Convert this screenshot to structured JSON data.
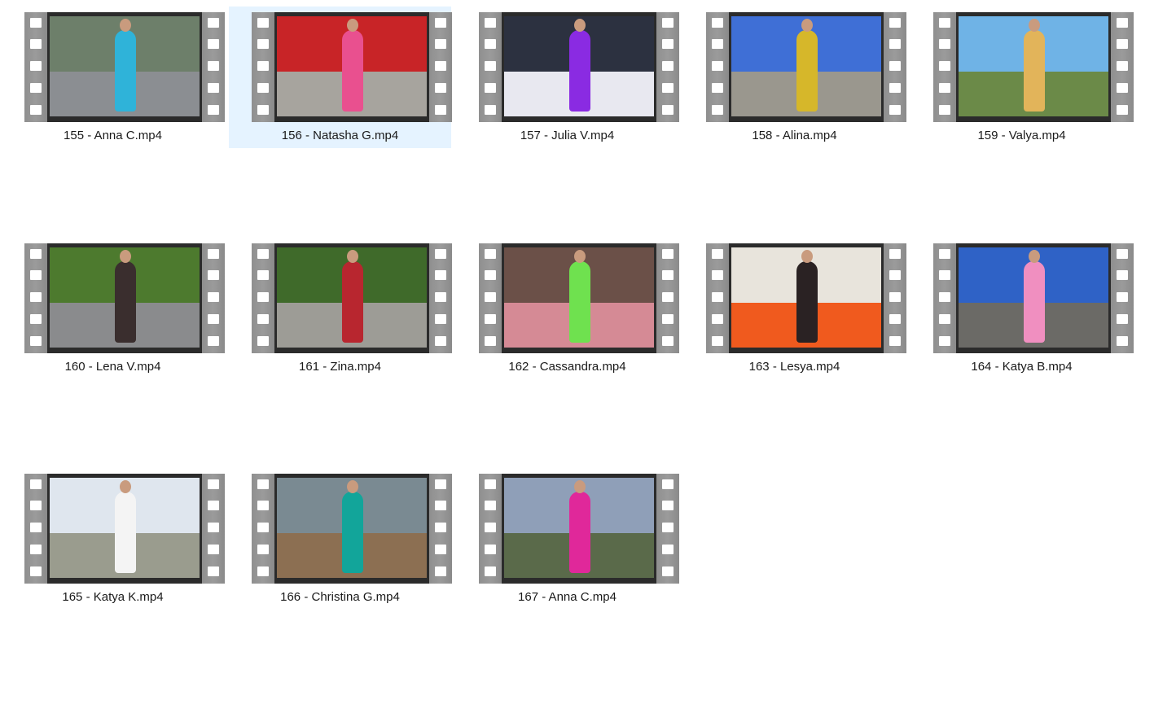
{
  "view": "large-icons",
  "selected_index": 1,
  "files": [
    {
      "name": "155 - Anna C.mp4",
      "sky": "#6d7f6a",
      "ground": "#8b8e92",
      "outfit": "#2fb3d9",
      "icon": "video-thumbnail-icon"
    },
    {
      "name": "156 - Natasha G.mp4",
      "sky": "#c82427",
      "ground": "#a7a49e",
      "outfit": "#e9508f",
      "icon": "video-thumbnail-icon"
    },
    {
      "name": "157 - Julia V.mp4",
      "sky": "#2c3140",
      "ground": "#e8e8f0",
      "outfit": "#8a2be2",
      "icon": "video-thumbnail-icon"
    },
    {
      "name": "158 - Alina.mp4",
      "sky": "#3f6fd6",
      "ground": "#9a978e",
      "outfit": "#d6b72a",
      "icon": "video-thumbnail-icon"
    },
    {
      "name": "159 - Valya.mp4",
      "sky": "#6fb3e6",
      "ground": "#6b8a48",
      "outfit": "#e2b45a",
      "icon": "video-thumbnail-icon"
    },
    {
      "name": "160 - Lena V.mp4",
      "sky": "#4d7a2e",
      "ground": "#8a8b8d",
      "outfit": "#3a2e2e",
      "icon": "video-thumbnail-icon"
    },
    {
      "name": "161 - Zina.mp4",
      "sky": "#3f6a2a",
      "ground": "#9d9c96",
      "outfit": "#b8262f",
      "icon": "video-thumbnail-icon"
    },
    {
      "name": "162 - Cassandra.mp4",
      "sky": "#6b5048",
      "ground": "#d58a95",
      "outfit": "#6fe14f",
      "icon": "video-thumbnail-icon"
    },
    {
      "name": "163 - Lesya.mp4",
      "sky": "#e8e4dc",
      "ground": "#f05a1e",
      "outfit": "#2a2223",
      "icon": "video-thumbnail-icon"
    },
    {
      "name": "164 - Katya B.mp4",
      "sky": "#2f62c6",
      "ground": "#6b6a66",
      "outfit": "#f08fc0",
      "icon": "video-thumbnail-icon"
    },
    {
      "name": "165 - Katya K.mp4",
      "sky": "#dfe6ee",
      "ground": "#9a9c8e",
      "outfit": "#f4f4f4",
      "icon": "video-thumbnail-icon"
    },
    {
      "name": "166 - Christina G.mp4",
      "sky": "#7a8a92",
      "ground": "#8c6f52",
      "outfit": "#12a59a",
      "icon": "video-thumbnail-icon"
    },
    {
      "name": "167 - Anna C.mp4",
      "sky": "#8f9fb8",
      "ground": "#5a6a4a",
      "outfit": "#e0289a",
      "icon": "video-thumbnail-icon"
    }
  ]
}
